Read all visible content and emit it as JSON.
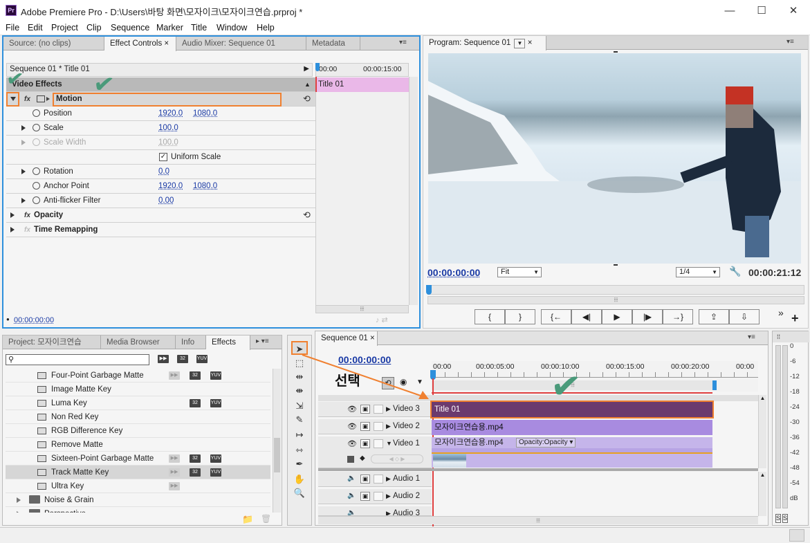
{
  "window": {
    "title": "Adobe Premiere Pro - D:\\Users\\바탕 화면\\모자이크\\모자이크연습.prproj *",
    "logo": "Pr",
    "minimize": "—",
    "maximize": "☐",
    "close": "✕"
  },
  "menu": [
    "File",
    "Edit",
    "Project",
    "Clip",
    "Sequence",
    "Marker",
    "Title",
    "Window",
    "Help"
  ],
  "ec_panel": {
    "tabs": [
      "Source: (no clips)",
      "Effect Controls",
      "Audio Mixer: Sequence 01",
      "Metadata"
    ],
    "close_glyph": "×",
    "breadcrumb": "Sequence 01 * Title 01",
    "timecode_start": "00:00",
    "timecode_end": "00:00:15:00",
    "clip_label": "Title 01",
    "section": "Video Effects",
    "motion": "Motion",
    "props": {
      "position": {
        "label": "Position",
        "x": "1920.0",
        "y": "1080.0"
      },
      "scale": {
        "label": "Scale",
        "v": "100.0"
      },
      "scale_width": {
        "label": "Scale Width",
        "v": "100.0"
      },
      "uniform": {
        "label": "Uniform Scale",
        "checked": true
      },
      "rotation": {
        "label": "Rotation",
        "v": "0.0"
      },
      "anchor": {
        "label": "Anchor Point",
        "x": "1920.0",
        "y": "1080.0"
      },
      "antiflicker": {
        "label": "Anti-flicker Filter",
        "v": "0.00"
      }
    },
    "opacity": "Opacity",
    "time_remap": "Time Remapping",
    "footer_tc": "00:00:00:00"
  },
  "program": {
    "tab": "Program: Sequence 01",
    "tc_current": "00:00:00:00",
    "fit": "Fit",
    "resolution": "1/4",
    "tc_duration": "00:00:21:12",
    "buttons": [
      "{",
      "}",
      "{←",
      "◀|",
      "▶",
      "|▶",
      "→}",
      "⇪",
      "⇩"
    ],
    "more": "»",
    "add": "+"
  },
  "project": {
    "tabs": [
      "Project: 모자이크연습",
      "Media Browser",
      "Info",
      "Effects"
    ],
    "search_placeholder": "",
    "badge_labels": [
      "32",
      "YUV"
    ],
    "effects": [
      {
        "name": "Four-Point Garbage Matte",
        "accel": true,
        "b32": true,
        "yuv": true
      },
      {
        "name": "Image Matte Key",
        "accel": false,
        "b32": false,
        "yuv": false
      },
      {
        "name": "Luma Key",
        "accel": false,
        "b32": true,
        "yuv": true
      },
      {
        "name": "Non Red Key",
        "accel": false,
        "b32": false,
        "yuv": false
      },
      {
        "name": "RGB Difference Key",
        "accel": false,
        "b32": false,
        "yuv": false
      },
      {
        "name": "Remove Matte",
        "accel": false,
        "b32": false,
        "yuv": false
      },
      {
        "name": "Sixteen-Point Garbage Matte",
        "accel": true,
        "b32": true,
        "yuv": true
      },
      {
        "name": "Track Matte Key",
        "accel": true,
        "b32": true,
        "yuv": true
      },
      {
        "name": "Ultra Key",
        "accel": true,
        "b32": false,
        "yuv": false
      }
    ],
    "folders": [
      "Noise & Grain",
      "Perspective"
    ]
  },
  "sequence": {
    "tab": "Sequence 01",
    "tc": "00:00:00:00",
    "ruler": [
      "00:00",
      "00:00:05:00",
      "00:00:10:00",
      "00:00:15:00",
      "00:00:20:00",
      "00:00"
    ],
    "selection_label": "선택",
    "tracks": {
      "v3": "Video 3",
      "v2": "Video 2",
      "v1": "Video 1",
      "a1": "Audio 1",
      "a2": "Audio 2",
      "a3": "Audio 3"
    },
    "clips": {
      "title": "Title 01",
      "mp4_v2": "모자이크연습용.mp4",
      "mp4_v1": "모자이크연습용.mp4",
      "opacity": "Opacity:Opacity"
    }
  },
  "meter": {
    "scale": [
      "0",
      "-6",
      "-12",
      "-18",
      "-24",
      "-30",
      "-36",
      "-42",
      "-48",
      "-54",
      "dB"
    ],
    "solo": [
      "S",
      "S"
    ]
  },
  "colors": {
    "accent": "#2d8fdc",
    "title_clip": "#6b3a6e",
    "mp4_clip": "#a88be0",
    "highlight": "#f08030",
    "check": "#4a9a7a",
    "playhead": "#e04040",
    "timecode": "#1a3aa5"
  }
}
